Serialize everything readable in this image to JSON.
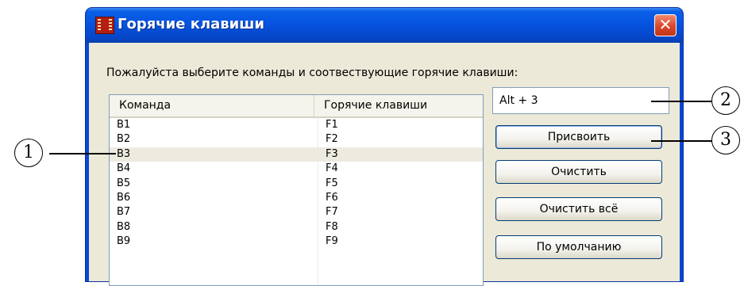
{
  "window": {
    "title": "Горячие клавиши",
    "close_glyph": "✕",
    "title_icon": "film-icon"
  },
  "instruction": "Пожалуйста выберите команды и соотвествующие горячие клавиши:",
  "table": {
    "columns": [
      "Команда",
      "Горячие клавиши"
    ],
    "rows": [
      {
        "command": "B1",
        "hotkey": "F1"
      },
      {
        "command": "B2",
        "hotkey": "F2"
      },
      {
        "command": "B3",
        "hotkey": "F3"
      },
      {
        "command": "B4",
        "hotkey": "F4"
      },
      {
        "command": "B5",
        "hotkey": "F5"
      },
      {
        "command": "B6",
        "hotkey": "F6"
      },
      {
        "command": "B7",
        "hotkey": "F7"
      },
      {
        "command": "B8",
        "hotkey": "F8"
      },
      {
        "command": "B9",
        "hotkey": "F9"
      }
    ],
    "selected_index": 2
  },
  "hotkey_field": {
    "value": "Alt + 3"
  },
  "buttons": {
    "assign": "Присвоить",
    "clear": "Очистить",
    "clear_all": "Очистить всё",
    "default": "По умолчанию"
  },
  "callouts": {
    "one": "1",
    "two": "2",
    "three": "3"
  },
  "colors": {
    "titlebar": "#0654e0",
    "client_bg": "#ece9d8",
    "selected_row": "#edebe0",
    "close_button": "#d9472b"
  }
}
